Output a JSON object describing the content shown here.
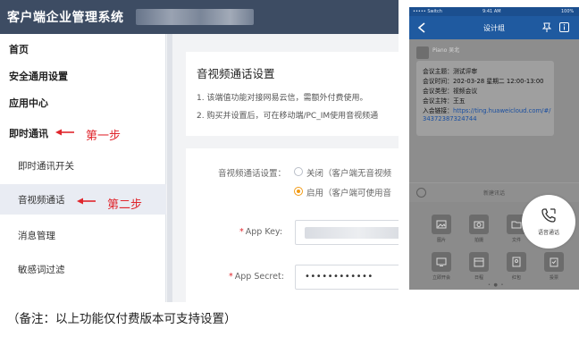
{
  "admin": {
    "app_title": "客户端企业管理系统",
    "sidebar": [
      {
        "label": "首页"
      },
      {
        "label": "安全通用设置"
      },
      {
        "label": "应用中心"
      },
      {
        "label": "即时通讯"
      },
      {
        "label": "即时通讯开关"
      },
      {
        "label": "音视频通话"
      },
      {
        "label": "消息管理"
      },
      {
        "label": "敏感词过滤"
      }
    ],
    "step1": "第一步",
    "step2": "第二步",
    "section": {
      "title": "音视频通话设置",
      "line1": "1. 该端值功能对接网易云信，需额外付费使用。",
      "line2": "2. 购买并设置后，可在移动端/PC_IM使用音视频通"
    },
    "form": {
      "toggle_label": "音视频通话设置：",
      "option_off": "关闭（客户端无音视频",
      "option_on": "启用（客户端可使用音",
      "appkey_label": "App Key:",
      "appsecret_label": "App Secret:",
      "appsecret_value": "••••••••••••"
    }
  },
  "phone": {
    "status": {
      "carrier": "••••• Switch",
      "time": "9:41 AM",
      "battery": "100%"
    },
    "nav_title": "设计组",
    "sender": "Piano 吴北",
    "message": {
      "topic": "会议主题：测试评审",
      "time": "会议时间：202-03-28 星期二 12:00-13:00",
      "type": "会议类型：视频会议",
      "host": "会议主持：王五",
      "link_label": "入会链接：",
      "link_part1": "https://ting.huaweicloud.com/#/",
      "link_part2": "34372387324744"
    },
    "input_placeholder": "新建讯话",
    "tray": [
      {
        "label": "图片",
        "icon": "image-icon"
      },
      {
        "label": "拍摄",
        "icon": "camera-icon"
      },
      {
        "label": "文件",
        "icon": "folder-icon"
      },
      {
        "label": "立即开会",
        "icon": "meeting-icon"
      },
      {
        "label": "日程",
        "icon": "calendar-icon"
      },
      {
        "label": "红包",
        "icon": "envelope-icon"
      },
      {
        "label": "投票",
        "icon": "vote-icon"
      }
    ],
    "voice_call_label": "语音通话"
  },
  "note": "（备注：以上功能仅付费版本可支持设置）",
  "colors": {
    "header": "#3d4c63",
    "accent_red": "#e0262d",
    "radio_orange": "#f29b16",
    "phone_blue": "#1f5aa0"
  }
}
